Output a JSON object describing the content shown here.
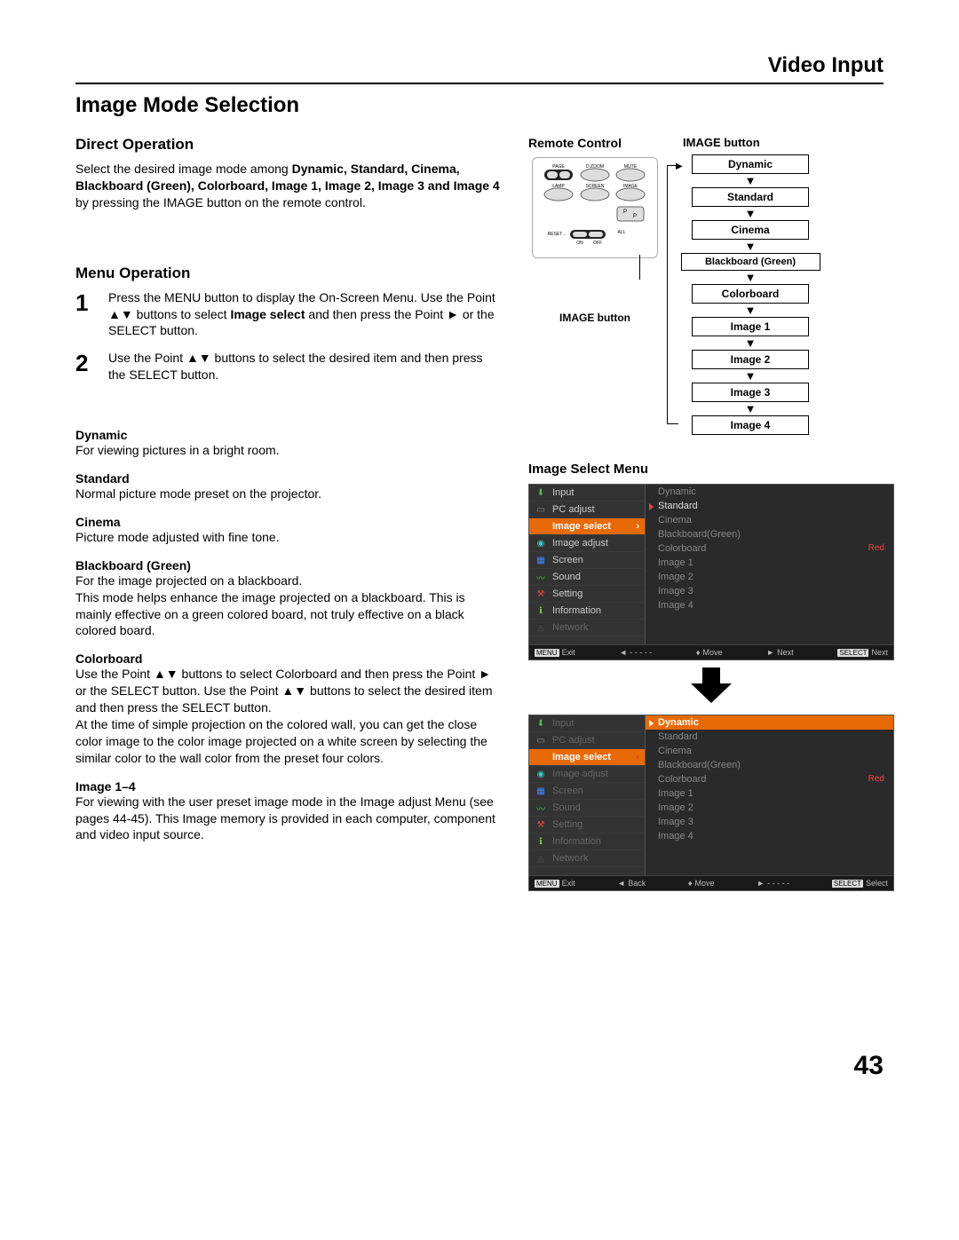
{
  "header": {
    "section": "Video Input"
  },
  "title": "Image Mode Selection",
  "direct": {
    "heading": "Direct Operation",
    "text_pre": "Select the desired image mode among ",
    "modes_bold": "Dynamic, Standard, Cinema, Blackboard (Green), Colorboard, Image 1, Image 2, Image 3 and Image 4",
    "text_post": " by pressing the IMAGE button on the remote control."
  },
  "remote": {
    "heading": "Remote Control",
    "caption": "IMAGE button",
    "buttons": {
      "page": "PAGE",
      "dzoom": "D.ZOOM",
      "mute": "MUTE",
      "lamp": "LAMP",
      "screen": "SCREEN",
      "image": "IMAGE",
      "pip": "P",
      "reset": "RESET",
      "all": "ALL",
      "on": "ON",
      "off": "OFF"
    }
  },
  "flow": {
    "title": "IMAGE button",
    "items": [
      "Dynamic",
      "Standard",
      "Cinema",
      "Blackboard (Green)",
      "Colorboard",
      "Image 1",
      "Image 2",
      "Image 3",
      "Image 4"
    ]
  },
  "menu": {
    "heading": "Menu Operation",
    "steps": [
      {
        "n": "1",
        "t1": "Press the MENU button to display the On-Screen Menu. Use the Point ▲▼ buttons to select ",
        "b": "Image select",
        "t2": " and then press the Point ► or the SELECT button."
      },
      {
        "n": "2",
        "t1": "Use the Point ▲▼ buttons to select the desired item and then press the SELECT button.",
        "b": "",
        "t2": ""
      }
    ]
  },
  "modes": [
    {
      "t": "Dynamic",
      "d": "For viewing pictures in a bright room."
    },
    {
      "t": "Standard",
      "d": "Normal picture mode preset on the projector."
    },
    {
      "t": "Cinema",
      "d": "Picture mode adjusted with fine tone."
    },
    {
      "t": "Blackboard (Green)",
      "d": "For the image projected on a blackboard.\nThis mode helps enhance the image projected on a blackboard. This is mainly effective on a green colored board, not truly effective on a black colored board."
    },
    {
      "t": "Colorboard",
      "d": "Use the Point ▲▼ buttons to select Colorboard and then press the Point ► or the SELECT button. Use the Point ▲▼ buttons to select the desired item and then press the SELECT button.\nAt the time of simple projection on the colored wall, you can get the close color image to the color image projected on a white screen by selecting the similar color to the wall color from the preset four colors."
    },
    {
      "t": "Image 1–4",
      "d": "For viewing with the user preset image mode in the Image adjust Menu (see pages 44-45). This Image memory is provided in each computer, component and video input source."
    }
  ],
  "osd_heading": "Image Select Menu",
  "osd": {
    "left_items": [
      {
        "icon": "⬇",
        "cls": "ic-green",
        "label": "Input"
      },
      {
        "icon": "▭",
        "cls": "ic-grey",
        "label": "PC adjust"
      },
      {
        "icon": "◧",
        "cls": "ic-orange",
        "label": "Image select",
        "hl": true
      },
      {
        "icon": "◉",
        "cls": "ic-teal",
        "label": "Image adjust"
      },
      {
        "icon": "▦",
        "cls": "ic-blue",
        "label": "Screen"
      },
      {
        "icon": "〰",
        "cls": "ic-green",
        "label": "Sound"
      },
      {
        "icon": "⚒",
        "cls": "ic-red",
        "label": "Setting"
      },
      {
        "icon": "ℹ",
        "cls": "ic-lime",
        "label": "Information"
      },
      {
        "icon": "◬",
        "cls": "ic-dgrey",
        "label": "Network",
        "dim": true
      }
    ],
    "right1": [
      "Dynamic",
      "Standard",
      "Cinema",
      "Blackboard(Green)",
      "Colorboard",
      "Image 1",
      "Image 2",
      "Image 3",
      "Image 4"
    ],
    "right1_sel": "Standard",
    "right1_colorboard_val": "Red",
    "right2_hl": "Dynamic",
    "footer1": {
      "exit": "Exit",
      "back_sym": "◄",
      "back": "- - - - -",
      "move_sym": "♦",
      "move": "Move",
      "next_sym": "►",
      "next": "Next",
      "sel_lbl": "SELECT",
      "sel": "Next"
    },
    "footer2": {
      "exit": "Exit",
      "back_sym": "◄",
      "back": "Back",
      "move_sym": "♦",
      "move": "Move",
      "next_sym": "►",
      "next": "- - - - -",
      "sel_lbl": "SELECT",
      "sel": "Select"
    },
    "menu_key": "MENU"
  },
  "page_num": "43"
}
